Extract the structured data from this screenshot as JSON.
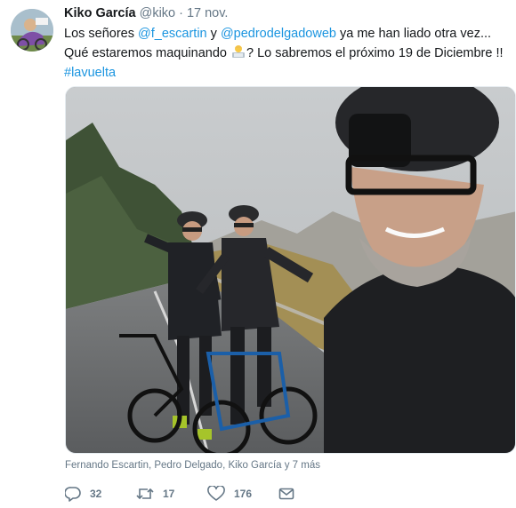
{
  "tweet": {
    "author_name": "Kiko García",
    "author_handle": "@kiko",
    "separator": "·",
    "time": "17 nov.",
    "text": {
      "part1": "Los señores ",
      "mention1": "@f_escartin",
      "part2": " y ",
      "mention2": "@pedrodelgadoweb",
      "part3": " ya me han liado otra vez... Qué estaremos maquinando ",
      "emoji": "man-technologist-emoji",
      "part4": "? Lo sabremos el próximo 19 de Diciembre !!",
      "hashtag": "#lavuelta"
    },
    "media_tagline": "Fernando Escartin, Pedro Delgado, Kiko García y 7 más",
    "actions": {
      "reply_count": "32",
      "retweet_count": "17",
      "like_count": "176"
    }
  },
  "colors": {
    "link": "#1b95e0",
    "secondary_text": "#657786",
    "primary_text": "#14171a"
  }
}
